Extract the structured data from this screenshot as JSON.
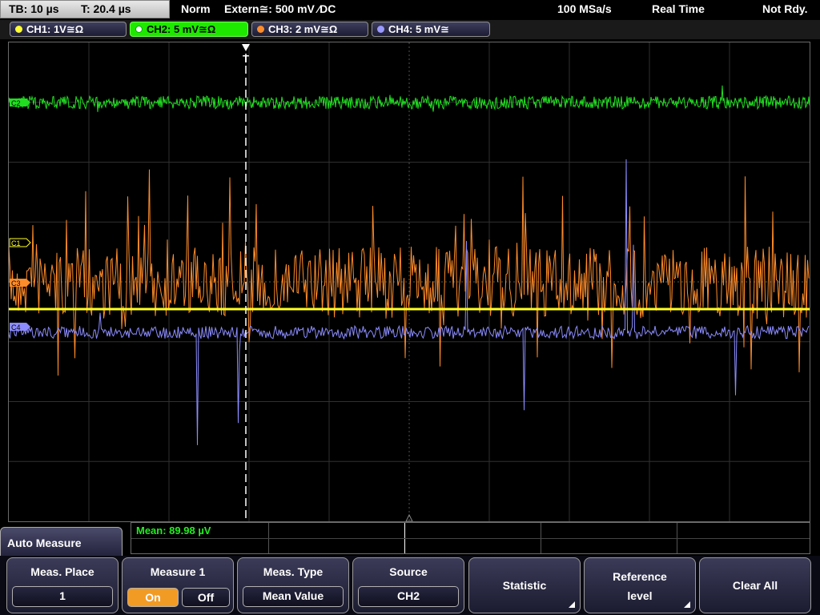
{
  "status_bar": {
    "timebase": "TB: 10 µs",
    "trigger_time": "T: 20.4 µs",
    "trigger_mode": "Norm",
    "trigger_source": "Extern≅: 500 mV ⁄DC",
    "sample_rate": "100 MSa/s",
    "acquisition_mode": "Real Time",
    "state": "Not Rdy."
  },
  "channels": [
    {
      "label": "CH1: 1V≅Ω",
      "color": "#ffff33",
      "active": false
    },
    {
      "label": "CH2: 5 mV≅Ω",
      "color": "#22ff22",
      "active": true
    },
    {
      "label": "CH3: 2 mV≅Ω",
      "color": "#ff8c2a",
      "active": false
    },
    {
      "label": "CH4: 5 mV≅",
      "color": "#9999ff",
      "active": false
    }
  ],
  "markers": {
    "c1": "C1",
    "c2": "C2",
    "c3": "C3",
    "c4": "C4",
    "trigger": "T"
  },
  "measurement": {
    "readout": "Mean: 89.98 µV"
  },
  "menu": {
    "title": "Auto Measure",
    "softkeys": {
      "meas_place": {
        "label": "Meas. Place",
        "value": "1"
      },
      "measure_1": {
        "label": "Measure 1",
        "on": "On",
        "off": "Off",
        "state": "On"
      },
      "meas_type": {
        "label": "Meas. Type",
        "value": "Mean Value"
      },
      "source": {
        "label": "Source",
        "value": "CH2"
      },
      "statistic": {
        "label": "Statistic"
      },
      "reference_level": {
        "line1": "Reference",
        "line2": "level"
      },
      "clear_all": {
        "label": "Clear All"
      }
    }
  }
}
